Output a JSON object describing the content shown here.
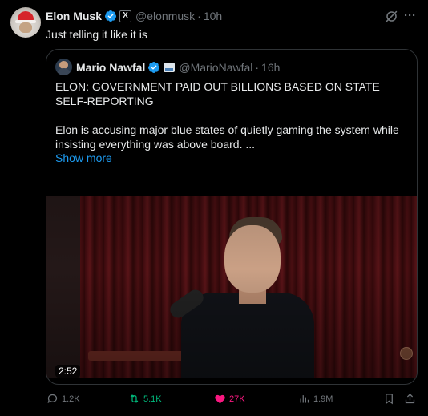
{
  "post": {
    "author_name": "Elon Musk",
    "author_handle": "@elonmusk",
    "separator": "·",
    "time": "10h",
    "text": "Just telling it like it is",
    "affiliation_badge_letter": "X"
  },
  "quote": {
    "author_name": "Mario Nawfal",
    "author_handle": "@MarioNawfal",
    "separator": "·",
    "time": "16h",
    "headline": "ELON: GOVERNMENT PAID OUT BILLIONS BASED ON STATE SELF-REPORTING",
    "body": "Elon is accusing major blue states of quietly gaming the system while insisting everything was above board. ...",
    "show_more": "Show more",
    "video_duration": "2:52"
  },
  "actions": {
    "replies": "1.2K",
    "reposts": "5.1K",
    "likes": "27K",
    "views": "1.9M"
  },
  "colors": {
    "verified": "#1d9bf0",
    "link": "#1d9bf0",
    "repost_active": "#00ba7c",
    "like_active": "#f91880",
    "muted": "#71767b"
  },
  "icons": [
    "verified-badge-icon",
    "x-affiliation-icon",
    "grok-icon",
    "more-icon",
    "image-badge-icon",
    "reply-icon",
    "repost-icon",
    "like-icon",
    "views-icon",
    "bookmark-icon",
    "share-icon"
  ]
}
